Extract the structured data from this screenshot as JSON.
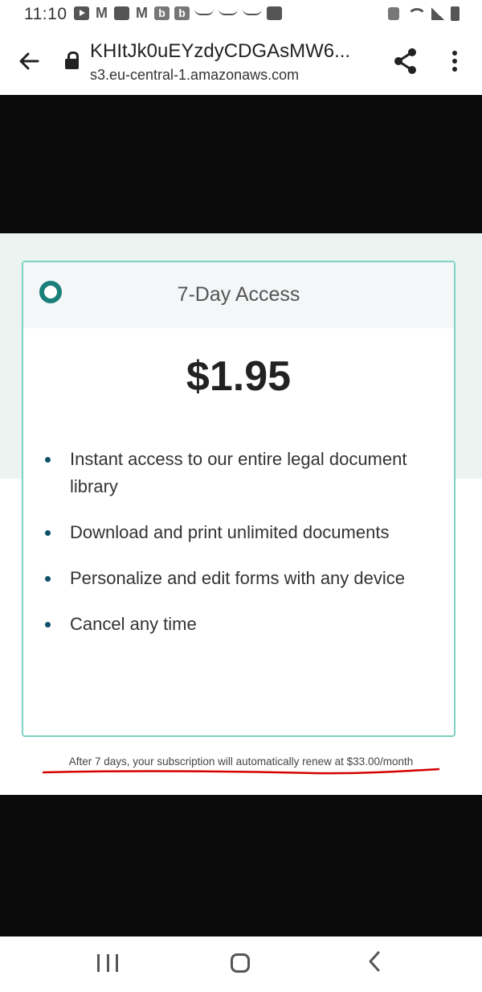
{
  "status_bar": {
    "time": "11:10",
    "left_icons": [
      "youtube-icon",
      "gmail-icon",
      "mail-icon",
      "gmail-icon",
      "b-app-icon",
      "b-app-icon",
      "wave-icon",
      "wave-icon",
      "wave-icon",
      "image-icon"
    ],
    "right_icons": [
      "battery-saver-icon",
      "wifi-icon",
      "signal-icon",
      "battery-icon"
    ]
  },
  "browser": {
    "page_title": "KHItJk0uEYzdyCDGAsMW6...",
    "host": "s3.eu-central-1.amazonaws.com"
  },
  "plan": {
    "name": "7-Day Access",
    "price": "$1.95",
    "features": [
      "Instant access to our entire legal document library",
      "Download and print unlimited documents",
      "Personalize and edit forms with any device",
      "Cancel any time"
    ],
    "renewal_note": "After 7 days, your subscription will automatically renew at $33.00/month"
  },
  "colors": {
    "accent": "#1a7f78",
    "card_border": "#7fd1c4",
    "band": "#ebf4f1",
    "underline": "#d40000"
  }
}
